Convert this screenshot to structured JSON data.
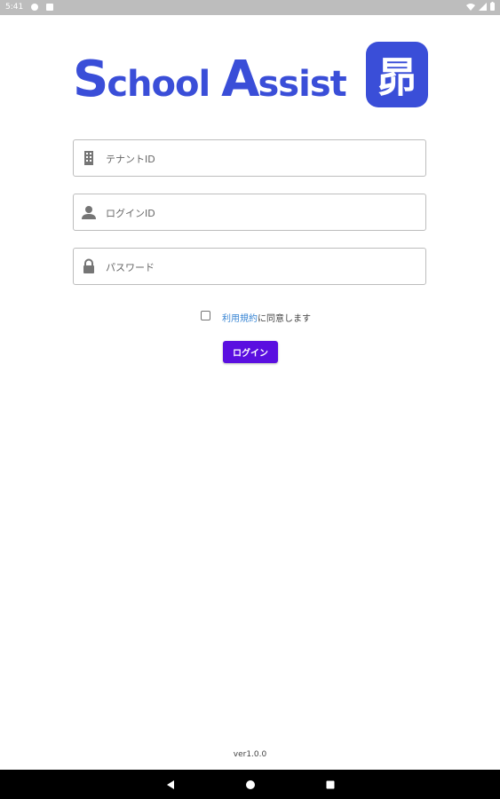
{
  "status_bar": {
    "time": "5:41",
    "icons": [
      "notification-f-icon",
      "notification-card-icon",
      "wifi-icon",
      "signal-icon",
      "battery-icon"
    ]
  },
  "logo": {
    "text_part1_initial": "S",
    "text_part1_rest": "chool ",
    "text_part2_initial": "A",
    "text_part2_rest": "ssist",
    "badge_char": "昴",
    "color": "#3a4ed8"
  },
  "form": {
    "tenant_placeholder": "テナントID",
    "login_id_placeholder": "ログインID",
    "password_placeholder": "パスワード",
    "tenant_icon": "building-icon",
    "login_icon": "person-icon",
    "password_icon": "lock-icon"
  },
  "terms": {
    "link_text": "利用規約",
    "rest_text": "に同意します",
    "checked": false,
    "link_color": "#3a86d4"
  },
  "login_button": {
    "label": "ログイン",
    "color": "#5a0fe0"
  },
  "footer": {
    "version": "ver1.0.0"
  },
  "nav_bar": {
    "icons": [
      "back-icon",
      "home-icon",
      "recents-icon"
    ]
  }
}
